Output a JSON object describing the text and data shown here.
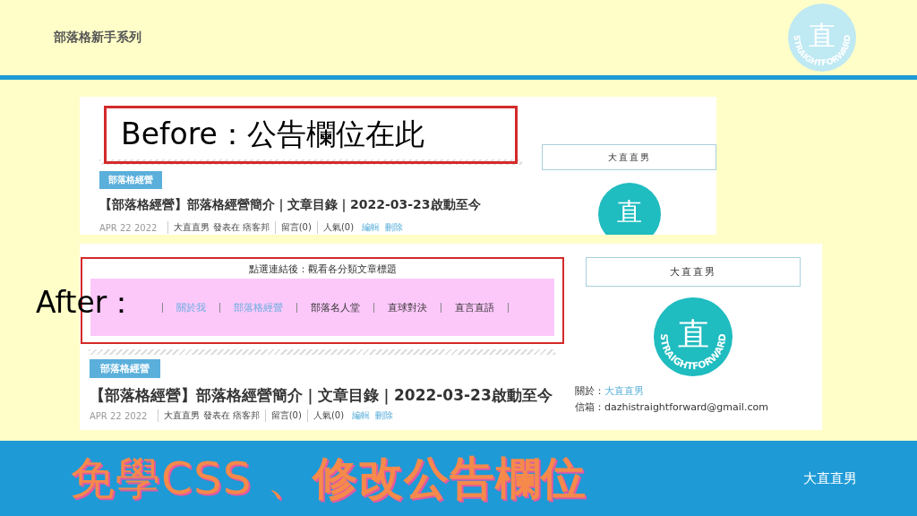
{
  "header": {
    "series_title": "部落格新手系列",
    "logo": {
      "glyph": "直",
      "caption": "STRAIGHTFORWARD"
    }
  },
  "before": {
    "label": "Before：公告欄位在此",
    "category_tag": "部落格經營",
    "post_title": "【部落格經營】部落格經營簡介｜文章目錄｜2022-03-23啟動至今",
    "post_meta": [
      {
        "text": "APR 22 2022",
        "kind": "date"
      },
      {
        "text": "大直直男 發表在 痞客邦",
        "kind": "plain"
      },
      {
        "text": "留言(0)",
        "kind": "plain"
      },
      {
        "text": "人氣(0)",
        "kind": "plain"
      },
      {
        "text": "編輯",
        "kind": "link"
      },
      {
        "text": "刪除",
        "kind": "link"
      }
    ],
    "sidebar_title": "大直直男",
    "logo": {
      "glyph": "直"
    }
  },
  "after": {
    "label": "After：",
    "notice_heading": "點選連結後：觀看各分類文章標題",
    "nav_links": [
      {
        "label": "關於我",
        "visited": true
      },
      {
        "label": "部落格經營",
        "visited": true
      },
      {
        "label": "部落名人堂",
        "visited": false
      },
      {
        "label": "直球對決",
        "visited": false
      },
      {
        "label": "直言直語",
        "visited": false
      }
    ],
    "category_tag": "部落格經營",
    "post_title": "【部落格經營】部落格經營簡介｜文章目錄｜2022-03-23啟動至今",
    "post_meta": [
      {
        "text": "APR 22 2022",
        "kind": "date"
      },
      {
        "text": "大直直男 發表在 痞客邦",
        "kind": "plain"
      },
      {
        "text": "留言(0)",
        "kind": "plain"
      },
      {
        "text": "人氣(0)",
        "kind": "plain"
      },
      {
        "text": "編輯",
        "kind": "link"
      },
      {
        "text": "刪除",
        "kind": "link"
      }
    ],
    "sidebar_title": "大直直男",
    "logo": {
      "glyph": "直",
      "caption": "STRAIGHTFORWARD"
    },
    "about_label": "關於：",
    "about_link": "大直直男",
    "email_line": "信箱：dazhistraightforward@gmail.com"
  },
  "footer": {
    "title": "免學CSS 、**修改公告欄位**",
    "author": "大直直男"
  }
}
